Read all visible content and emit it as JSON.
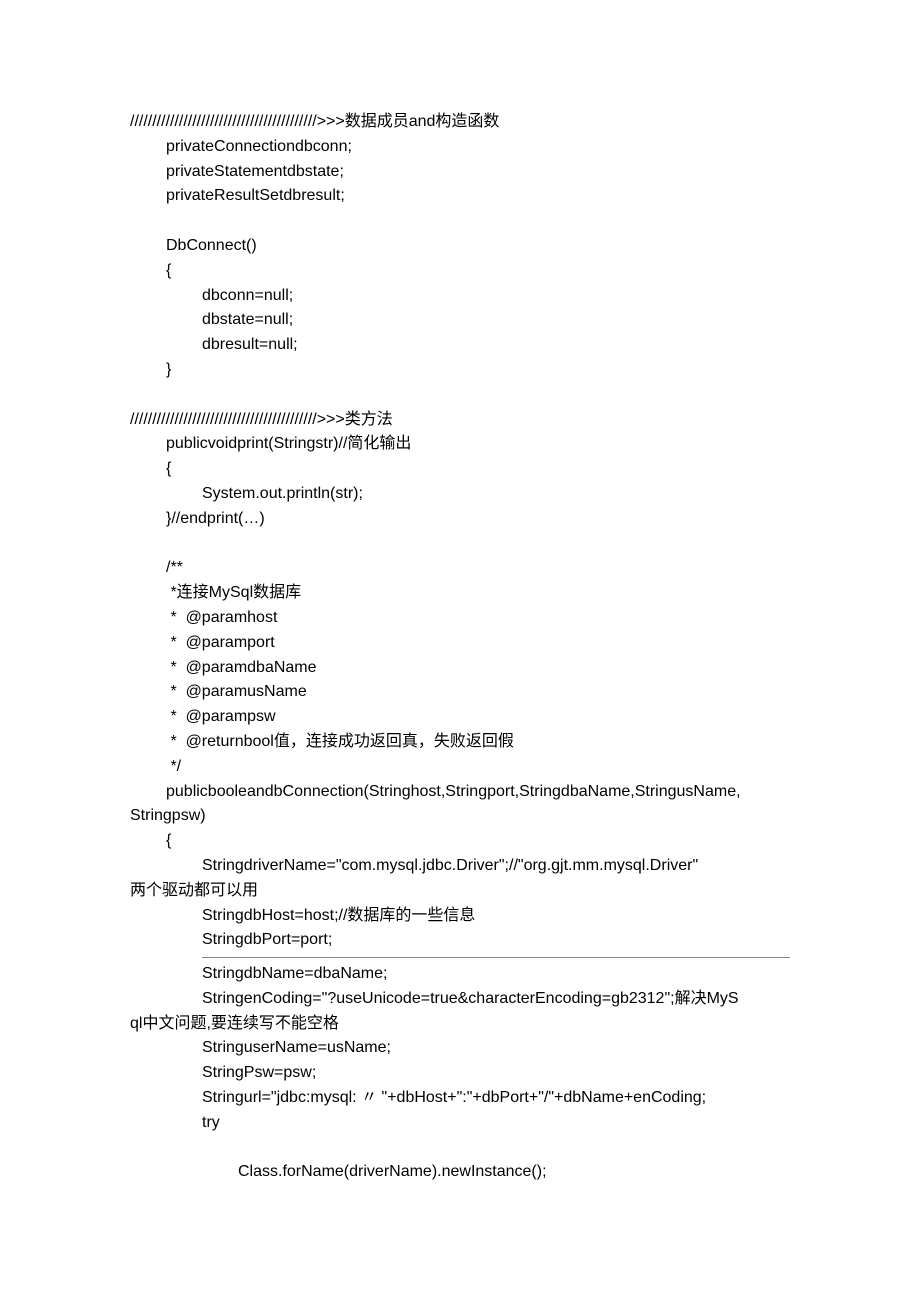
{
  "lines": [
    {
      "text": "//////////////////////////////////////////>>>数据成员and构造函数",
      "indent": 0
    },
    {
      "text": "privateConnectiondbconn;",
      "indent": 1
    },
    {
      "text": "privateStatementdbstate;",
      "indent": 1
    },
    {
      "text": "privateResultSetdbresult;",
      "indent": 1
    },
    {
      "text": "",
      "indent": 1,
      "blank": true
    },
    {
      "text": "DbConnect()",
      "indent": 1
    },
    {
      "text": "{",
      "indent": 1
    },
    {
      "text": "dbconn=null;",
      "indent": 2
    },
    {
      "text": "dbstate=null;",
      "indent": 2
    },
    {
      "text": "dbresult=null;",
      "indent": 2
    },
    {
      "text": "}",
      "indent": 1
    },
    {
      "text": "",
      "indent": 0,
      "blank": true
    },
    {
      "text": "//////////////////////////////////////////>>>类方法",
      "indent": 0
    },
    {
      "text": "publicvoidprint(Stringstr)//简化输出",
      "indent": 1
    },
    {
      "text": "{",
      "indent": 1
    },
    {
      "text": "System.out.println(str);",
      "indent": 2
    },
    {
      "text": "}//endprint(…)",
      "indent": 1
    },
    {
      "text": "",
      "indent": 1,
      "blank": true
    },
    {
      "text": "/**",
      "indent": 1
    },
    {
      "text": " *连接MySql数据库",
      "indent": 1
    },
    {
      "text": " *  @paramhost",
      "indent": 1
    },
    {
      "text": " *  @paramport",
      "indent": 1
    },
    {
      "text": " *  @paramdbaName",
      "indent": 1
    },
    {
      "text": " *  @paramusName",
      "indent": 1
    },
    {
      "text": " *  @parampsw",
      "indent": 1
    },
    {
      "text": " *  @returnbool值，连接成功返回真，失败返回假",
      "indent": 1
    },
    {
      "text": " */",
      "indent": 1
    },
    {
      "text": "publicbooleandbConnection(Stringhost,Stringport,StringdbaName,StringusName,",
      "indent": 1
    }
  ],
  "wrap1": "Stringpsw)",
  "after_wrap1": [
    {
      "text": "{",
      "indent": 1
    },
    {
      "text": "StringdriverName=\"com.mysql.jdbc.Driver\";//\"org.gjt.mm.mysql.Driver\"",
      "indent": 2
    }
  ],
  "wrap2": "两个驱动都可以用",
  "after_wrap2": [
    {
      "text": "StringdbHost=host;//数据库的一些信息",
      "indent": 2
    },
    {
      "text": "StringdbPort=port;",
      "indent": 2
    }
  ],
  "after_hr": [
    {
      "text": "StringdbName=dbaName;",
      "indent": 2
    },
    {
      "text": "StringenCoding=\"?useUnicode=true&characterEncoding=gb2312\";解决MyS",
      "indent": 2
    }
  ],
  "wrap3": "ql中文问题,要连续写不能空格",
  "after_wrap3": [
    {
      "text": "StringuserName=usName;",
      "indent": 2
    },
    {
      "text": "StringPsw=psw;",
      "indent": 2
    },
    {
      "text": "Stringurl=\"jdbc:mysql: 〃 \"+dbHost+\":\"+dbPort+\"/\"+dbName+enCoding;",
      "indent": 2
    },
    {
      "text": "try",
      "indent": 2
    },
    {
      "text": "",
      "indent": 2,
      "blank": true
    },
    {
      "text": "Class.forName(driverName).newInstance();",
      "indent": 3
    }
  ]
}
